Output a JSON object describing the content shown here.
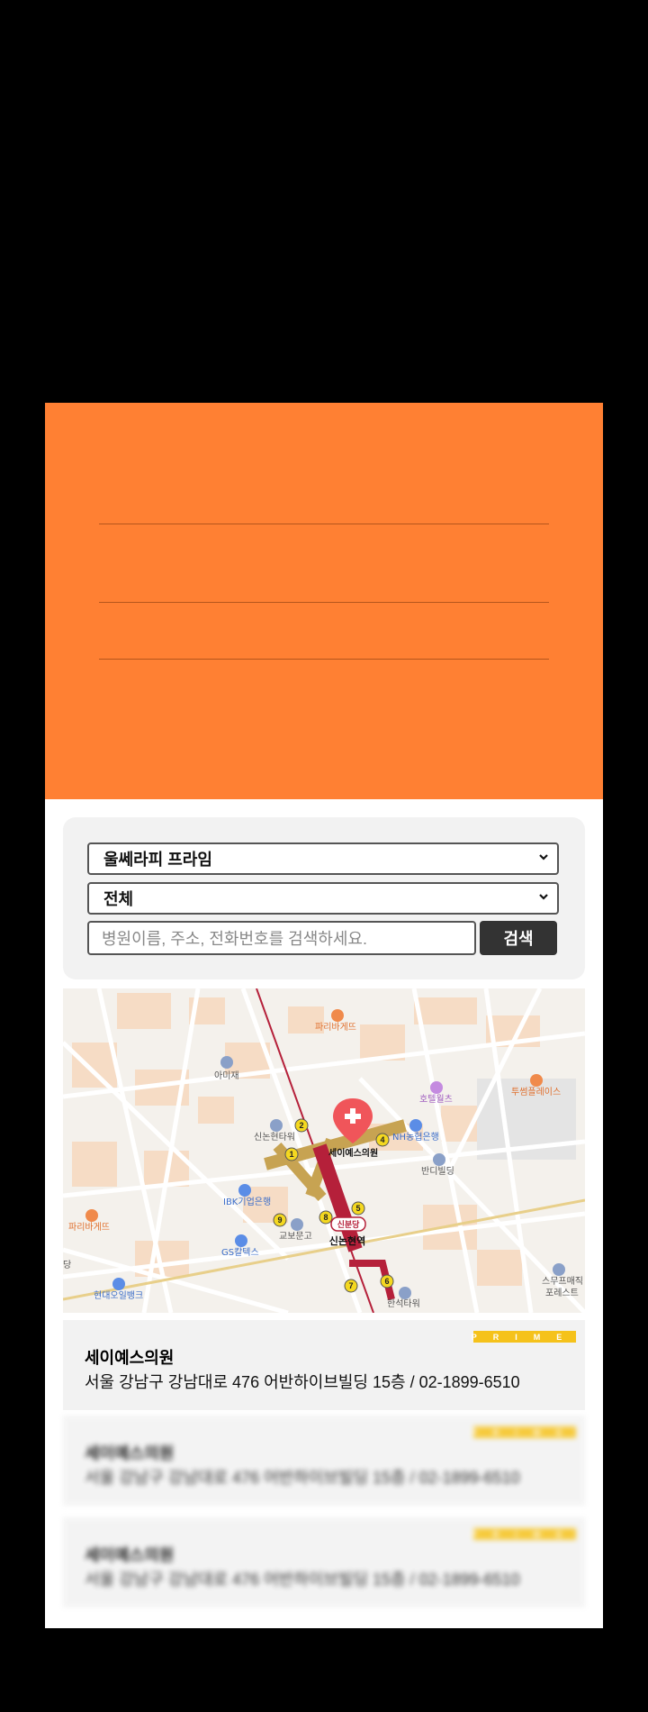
{
  "filters": {
    "treatment": "울쎄라피 프라임",
    "region": "전체"
  },
  "search": {
    "placeholder": "병원이름, 주소, 전화번호를 검색하세요.",
    "button_label": "검색"
  },
  "map": {
    "labels": {
      "paris1": "파리바게뜨",
      "amije": "아미재",
      "hotelwalls": "호텔월츠",
      "twosome": "투썸플레이스",
      "sinnonhyeon_tower": "신논현타워",
      "nh": "NH농협은행",
      "clinic": "세이예스의원",
      "bandi": "반디빌딩",
      "ibk": "IBK기업은행",
      "paris2": "파리바게뜨",
      "kyobo": "교보문고",
      "gs": "GS칼텍스",
      "station_badge": "신분당",
      "station": "신논현역",
      "hyundai": "현대오일뱅크",
      "hanseok": "한석타워",
      "smoothie": "스무프매직",
      "forest": "포레스트",
      "left_edge": "당"
    },
    "exits": [
      "1",
      "2",
      "4",
      "5",
      "6",
      "7",
      "8",
      "9"
    ]
  },
  "results": [
    {
      "badge": "PRIME",
      "name": "세이예스의원",
      "address": "서울 강남구 강남대로 476 어반하이브빌딩 15층 / 02-1899-6510"
    },
    {
      "badge": "PRIME",
      "name": "세이예스의원",
      "address": "서울 강남구 강남대로 476 어반하이브빌딩 15층 / 02-1899-6510"
    },
    {
      "badge": "PRIME",
      "name": "세이예스의원",
      "address": "서울 강남구 강남대로 476 어반하이브빌딩 15층 / 02-1899-6510"
    }
  ],
  "colors": {
    "hero": "#ff8033",
    "badge": "#f5c21b",
    "subway_line": "#b5203a"
  }
}
